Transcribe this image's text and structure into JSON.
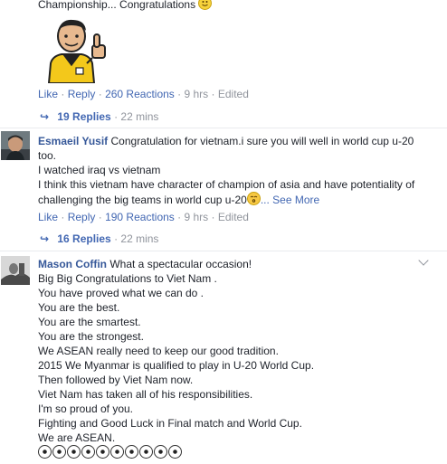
{
  "comment0": {
    "text_tail": "Championship... Congratulations",
    "actions": {
      "like": "Like",
      "reply": "Reply",
      "reactions": "260 Reactions",
      "time": "9 hrs",
      "edited": "Edited"
    },
    "replies": {
      "label": "19 Replies",
      "time": "22 mins"
    }
  },
  "comment1": {
    "author": "Esmaeil Yusif",
    "lines": [
      "Congratulation for vietnam.i sure you will well in world cup u-20",
      "too.",
      "I watched iraq vs vietnam",
      "I think this vietnam have character of champion of asia and have potentiality of",
      "challenging the big teams in world cup u-20"
    ],
    "see_more": "... See More",
    "actions": {
      "like": "Like",
      "reply": "Reply",
      "reactions": "190 Reactions",
      "time": "9 hrs",
      "edited": "Edited"
    },
    "replies": {
      "label": "16 Replies",
      "time": "22 mins"
    }
  },
  "comment2": {
    "author": "Mason Coffin",
    "lines": [
      "What a spectacular occasion!",
      "Big Big Congratulations to Viet Nam .",
      "You have proved what we can do .",
      "You are the best.",
      "You are the smartest.",
      "You are the strongest.",
      "We ASEAN really need to keep our good tradition.",
      "2015 We Myanmar is qualified to play in U-20 World Cup.",
      "Then followed by Viet Nam now.",
      "Viet Nam has taken all of his responsibilities.",
      "I'm so proud of you.",
      "Fighting and Good Luck in Final match and World Cup.",
      "We are ASEAN."
    ],
    "soccer_balls": 10
  },
  "colors": {
    "link": "#4267b2",
    "name": "#365899",
    "meta": "#90949c",
    "text": "#1d2129"
  }
}
